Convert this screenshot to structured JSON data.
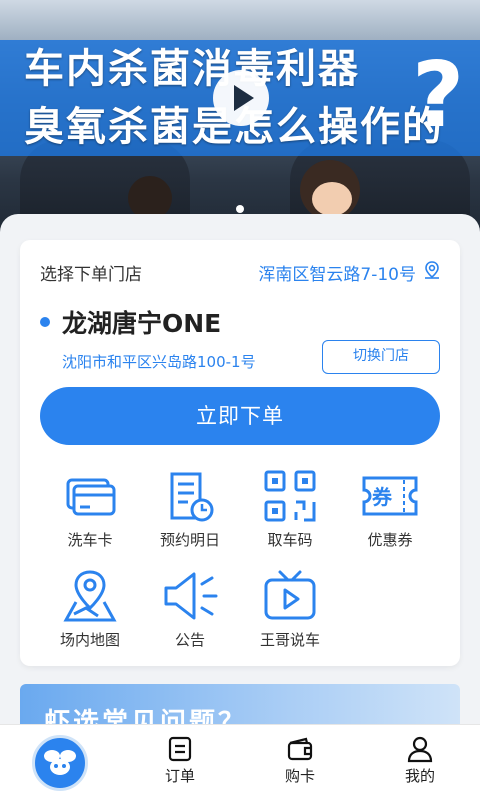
{
  "banner": {
    "title_line1": "车内杀菌消毒利器",
    "title_line2": "臭氧杀菌是怎么操作的",
    "question_mark": "?"
  },
  "store": {
    "select_label": "选择下单门店",
    "current_location": "浑南区智云路7-10号",
    "name": "龙湖唐宁ONE",
    "address": "沈阳市和平区兴岛路100-1号",
    "switch_label": "切换门店",
    "order_label": "立即下单"
  },
  "services": [
    {
      "label": "洗车卡",
      "icon": "car-wash-card-icon"
    },
    {
      "label": "预约明日",
      "icon": "calendar-clock-icon"
    },
    {
      "label": "取车码",
      "icon": "qr-code-icon"
    },
    {
      "label": "优惠券",
      "icon": "coupon-icon"
    },
    {
      "label": "场内地图",
      "icon": "map-pin-icon"
    },
    {
      "label": "公告",
      "icon": "speaker-icon"
    },
    {
      "label": "王哥说车",
      "icon": "video-tv-icon"
    }
  ],
  "promo": {
    "text": "虾选常见问题？"
  },
  "tabs": [
    {
      "label": "",
      "icon": "home-logo-icon"
    },
    {
      "label": "订单",
      "icon": "order-icon"
    },
    {
      "label": "购卡",
      "icon": "wallet-icon"
    },
    {
      "label": "我的",
      "icon": "user-icon"
    }
  ],
  "colors": {
    "accent": "#2b83ee",
    "background": "#f1f3f6"
  }
}
